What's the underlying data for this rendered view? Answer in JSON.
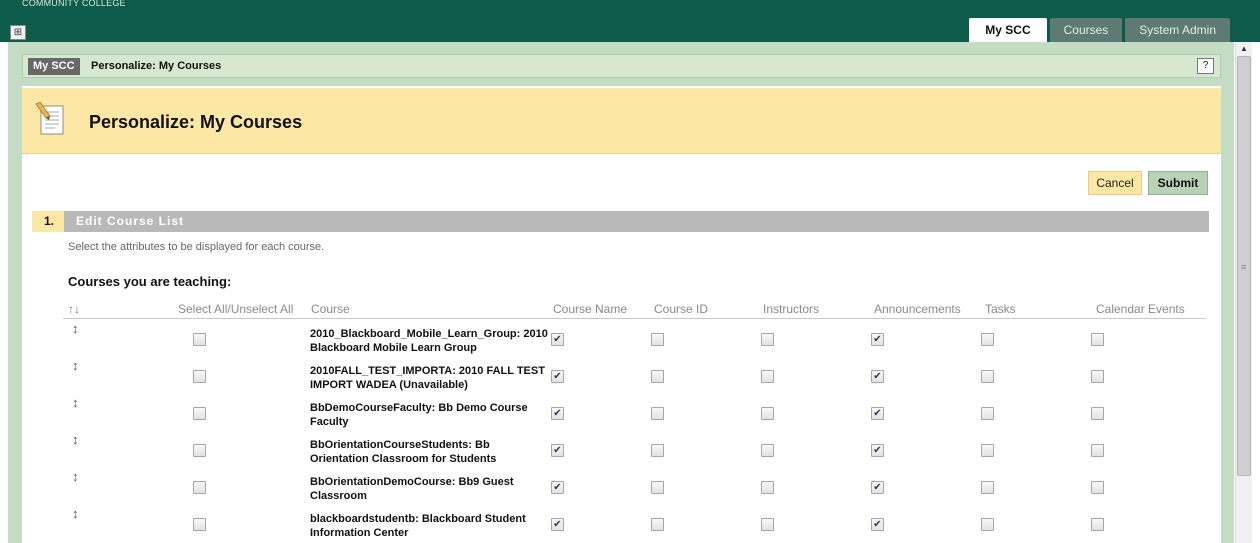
{
  "app": {
    "brand": "COMMUNITY COLLEGE",
    "top_tabs": [
      {
        "label": "My SCC",
        "active": true
      },
      {
        "label": "Courses",
        "active": false
      },
      {
        "label": "System Admin",
        "active": false
      }
    ]
  },
  "breadcrumb": {
    "home": "My SCC",
    "current": "Personalize: My Courses",
    "help_label": "?"
  },
  "page": {
    "title": "Personalize: My Courses",
    "cancel_label": "Cancel",
    "submit_label": "Submit"
  },
  "step": {
    "number": "1.",
    "title": "Edit Course List",
    "instructions": "Select the attributes to be displayed for each course."
  },
  "section": {
    "heading": "Courses you are teaching:"
  },
  "table": {
    "sort_icon": "↑↓",
    "columns": {
      "select_all": "Select All/Unselect All",
      "course": "Course",
      "course_name": "Course Name",
      "course_id": "Course ID",
      "instructors": "Instructors",
      "announcements": "Announcements",
      "tasks": "Tasks",
      "calendar_events": "Calendar Events"
    },
    "rows": [
      {
        "course": "2010_Blackboard_Mobile_Learn_Group: 2010 Blackboard Mobile Learn Group",
        "select": false,
        "course_name": true,
        "course_id": false,
        "instructors": false,
        "announcements": true,
        "tasks": false,
        "calendar_events": false
      },
      {
        "course": "2010FALL_TEST_IMPORTA: 2010 FALL TEST IMPORT WADEA  (Unavailable)",
        "select": false,
        "course_name": true,
        "course_id": false,
        "instructors": false,
        "announcements": true,
        "tasks": false,
        "calendar_events": false
      },
      {
        "course": "BbDemoCourseFaculty: Bb Demo Course Faculty",
        "select": false,
        "course_name": true,
        "course_id": false,
        "instructors": false,
        "announcements": true,
        "tasks": false,
        "calendar_events": false
      },
      {
        "course": "BbOrientationCourseStudents: Bb Orientation Classroom for Students",
        "select": false,
        "course_name": true,
        "course_id": false,
        "instructors": false,
        "announcements": true,
        "tasks": false,
        "calendar_events": false
      },
      {
        "course": "BbOrientationDemoCourse: Bb9 Guest Classroom",
        "select": false,
        "course_name": true,
        "course_id": false,
        "instructors": false,
        "announcements": true,
        "tasks": false,
        "calendar_events": false
      },
      {
        "course": "blackboardstudentb: Blackboard Student Information Center",
        "select": false,
        "course_name": true,
        "course_id": false,
        "instructors": false,
        "announcements": true,
        "tasks": false,
        "calendar_events": false
      }
    ]
  }
}
